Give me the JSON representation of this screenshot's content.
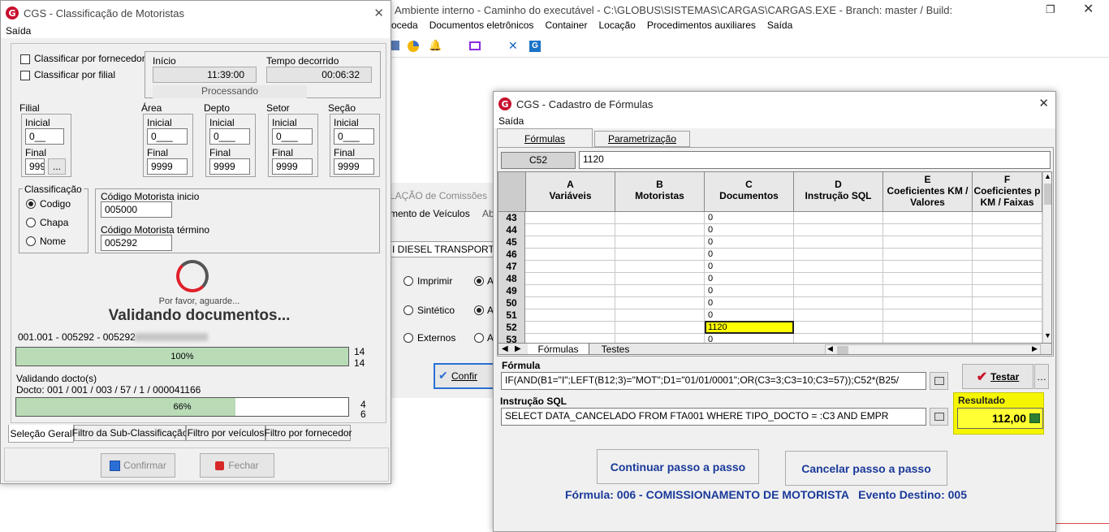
{
  "background": {
    "title": "Ambiente interno - Caminho do executável - C:\\GLOBUS\\SISTEMAS\\CARGAS\\CARGAS.EXE - Branch: master / Build:",
    "menu": [
      "roceda",
      "Documentos eletrônicos",
      "Container",
      "Locação",
      "Procedimentos auxiliares",
      "Saída"
    ],
    "partial_texts": {
      "comissoes": "LAÇÃO de Comissões",
      "veiculos": "mento de Veículos",
      "ab": "Ab",
      "diesel": "I DIESEL TRANSPORTE E",
      "imprimir": "Imprimir",
      "sintetico": "Sintético",
      "externos": "Externos",
      "a": "A",
      "confirm": "Confir"
    }
  },
  "classif": {
    "title": "CGS - Classificação de Motoristas",
    "menu_saida": "Saída",
    "chk_fornecedor": "Classificar por fornecedor",
    "chk_filial": "Classificar por filial",
    "inicio_label": "Início",
    "inicio_value": "11:39:00",
    "decorrido_label": "Tempo decorrido",
    "decorrido_value": "00:06:32",
    "processando": "Processando",
    "groups": [
      {
        "title": "Filial",
        "inicial": "0__",
        "final": "999"
      },
      {
        "title": "Área",
        "inicial": "0___",
        "final": "9999"
      },
      {
        "title": "Depto",
        "inicial": "0___",
        "final": "9999"
      },
      {
        "title": "Setor",
        "inicial": "0___",
        "final": "9999"
      },
      {
        "title": "Seção",
        "inicial": "0___",
        "final": "9999"
      }
    ],
    "inicial_label": "Inicial",
    "final_label": "Final",
    "ellipsis": "...",
    "classificacao_title": "Classificação",
    "radios": [
      "Codigo",
      "Chapa",
      "Nome"
    ],
    "cod_inicio_label": "Código Motorista inicio",
    "cod_inicio_value": "005000",
    "cod_termino_label": "Código Motorista término",
    "cod_termino_value": "005292",
    "aguarde": "Por favor, aguarde...",
    "validando": "Validando documentos...",
    "doc_line": "001.001 - 005292 - 005292 -",
    "progress1": {
      "label": "100%",
      "fraction": 1.0,
      "count_a": "14",
      "count_b": "14"
    },
    "validando_docto": "Validando docto(s)",
    "docto_line": "Docto: 001 / 001 / 003 / 57 / 1 / 000041166",
    "progress2": {
      "label": "66%",
      "fraction": 0.66,
      "count_a": "4",
      "count_b": "6"
    },
    "tabs": [
      "Seleção Geral",
      "Filtro da Sub-Classificação",
      "Filtro por veículos",
      "Filtro por fornecedor"
    ],
    "btn_confirmar": "Confirmar",
    "btn_fechar": "Fechar"
  },
  "formulas": {
    "title": "CGS - Cadastro de Fórmulas",
    "menu_saida": "Saída",
    "tabs": [
      "Fórmulas",
      "Parametrização"
    ],
    "cell_ref": "C52",
    "cell_value": "1120",
    "columns": [
      {
        "letter": "A",
        "name": "Variáveis"
      },
      {
        "letter": "B",
        "name": "Motoristas"
      },
      {
        "letter": "C",
        "name": "Documentos"
      },
      {
        "letter": "D",
        "name": "Instrução SQL"
      },
      {
        "letter": "E",
        "name": "Coeficientes KM / Valores"
      },
      {
        "letter": "F",
        "name": "Coeficientes p KM / Faixas"
      }
    ],
    "rows": [
      {
        "n": "43",
        "c": "0"
      },
      {
        "n": "44",
        "c": "0"
      },
      {
        "n": "45",
        "c": "0"
      },
      {
        "n": "46",
        "c": "0"
      },
      {
        "n": "47",
        "c": "0"
      },
      {
        "n": "48",
        "c": "0"
      },
      {
        "n": "49",
        "c": "0"
      },
      {
        "n": "50",
        "c": "0"
      },
      {
        "n": "51",
        "c": "0"
      },
      {
        "n": "52",
        "c": "1120"
      },
      {
        "n": "53",
        "c": "0"
      }
    ],
    "sheet_tabs": [
      "Fórmulas",
      "Testes"
    ],
    "formula_label": "Fórmula",
    "formula_value": "IF(AND(B1=\"I\";LEFT(B12;3)=\"MOT\";D1=\"01/01/0001\";OR(C3=3;C3=10;C3=57));C52*(B25/",
    "sql_label": "Instrução SQL",
    "sql_value": "SELECT DATA_CANCELADO FROM FTA001 WHERE TIPO_DOCTO = :C3 AND EMPR",
    "btn_testar": "Testar",
    "resultado_label": "Resultado",
    "resultado_value": "112,00",
    "btn_continuar": "Continuar passo a passo",
    "btn_cancelar": "Cancelar passo a passo",
    "footer": "Fórmula: 006 - COMISSIONAMENTO DE MOTORISTA   Evento Destino: 005"
  }
}
